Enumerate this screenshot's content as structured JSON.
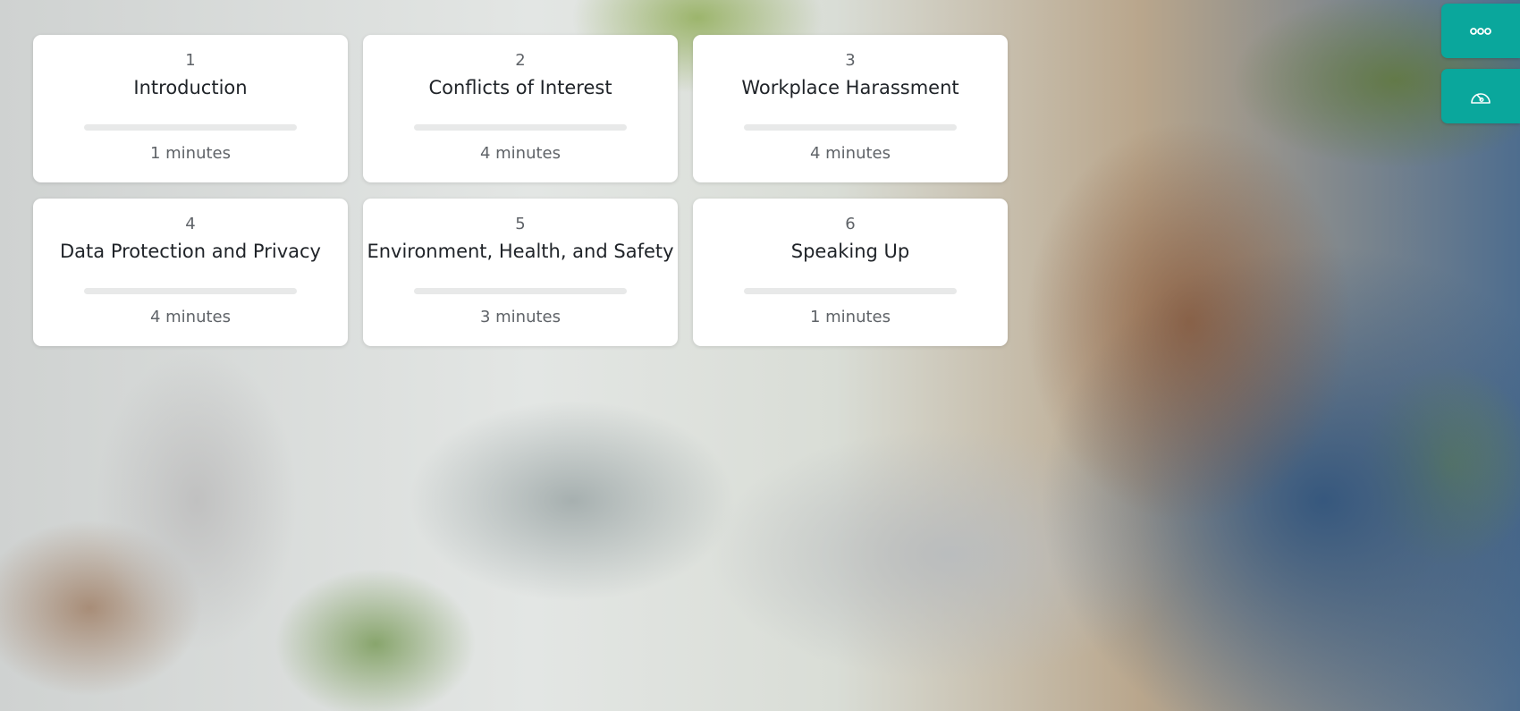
{
  "lessons": [
    {
      "number": "1",
      "title": "Introduction",
      "duration": "1 minutes",
      "progress": 0
    },
    {
      "number": "2",
      "title": "Conflicts of Interest",
      "duration": "4 minutes",
      "progress": 0
    },
    {
      "number": "3",
      "title": "Workplace Harassment",
      "duration": "4 minutes",
      "progress": 0
    },
    {
      "number": "4",
      "title": "Data Protection and Privacy",
      "duration": "4 minutes",
      "progress": 0
    },
    {
      "number": "5",
      "title": "Environment, Health, and Safety",
      "duration": "3 minutes",
      "progress": 0
    },
    {
      "number": "6",
      "title": "Speaking Up",
      "duration": "1 minutes",
      "progress": 0
    }
  ],
  "side_buttons": [
    {
      "icon": "more-circles-icon",
      "label": "Menu"
    },
    {
      "icon": "gauge-icon",
      "label": "Progress"
    }
  ],
  "colors": {
    "accent": "#0aa79c",
    "card_bg": "#ffffff",
    "progress_track": "#e8e9e9",
    "title_text": "#1f2328",
    "muted_text": "#5f6368"
  }
}
